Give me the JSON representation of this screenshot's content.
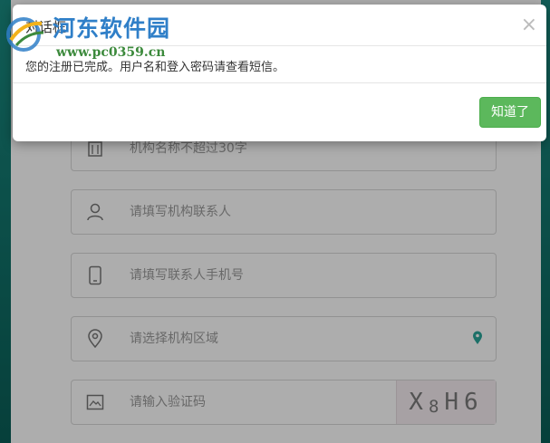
{
  "form": {
    "org_name_placeholder": "机构名称不超过30字",
    "contact_placeholder": "请填写机构联系人",
    "phone_placeholder": "请填写联系人手机号",
    "region_placeholder": "请选择机构区域",
    "captcha_placeholder": "请输入验证码",
    "captcha_chars": [
      "X",
      "8",
      "H",
      "6"
    ]
  },
  "dialog": {
    "title": "对话框",
    "close_label": "×",
    "message": "您的注册已完成。用户名和登入密码请查看短信。",
    "ok_label": "知道了"
  },
  "watermark": {
    "title": "河东软件园",
    "url": "www.pc0359.cn"
  },
  "colors": {
    "ok_button": "#5cb85c",
    "accent_teal": "#2aa59a",
    "watermark_blue": "#2f7fc8",
    "watermark_green": "#3c8a3c"
  },
  "icons": {
    "org": "building-icon",
    "contact": "user-icon",
    "phone": "phone-icon",
    "region": "location-icon",
    "region_action": "map-pin-icon",
    "captcha": "image-icon",
    "close": "close-icon"
  }
}
